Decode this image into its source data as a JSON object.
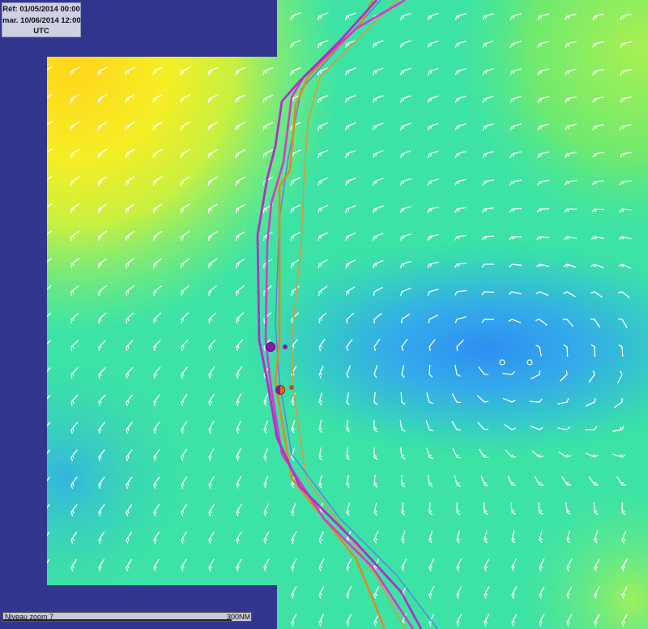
{
  "info": {
    "reference": "Réf: 01/05/2014 00:00",
    "date": "mar. 10/06/2014 12:00",
    "timezone": "UTC"
  },
  "scale": {
    "zoom_label": "Niveau zoom 7",
    "distance_label": "300NM"
  },
  "colors": {
    "no_data": "#33368f",
    "high_wind": "#ffd91a",
    "mid_wind": "#3ce3a5",
    "low_wind": "#2f9cf0",
    "route_purple": "#b030c8",
    "route_magenta": "#d838c8",
    "route_orange": "#e08a1e",
    "route_orange_light": "#d89a40",
    "route_blue": "#5a7cf0",
    "barbs": "#ffffff"
  },
  "map_layers": {
    "wind_field": "wind-speed-gradient",
    "barbs": "wind-barb-icon",
    "routes": [
      "route_purple",
      "route_magenta",
      "route_orange",
      "route_orange_light",
      "route_blue"
    ]
  }
}
